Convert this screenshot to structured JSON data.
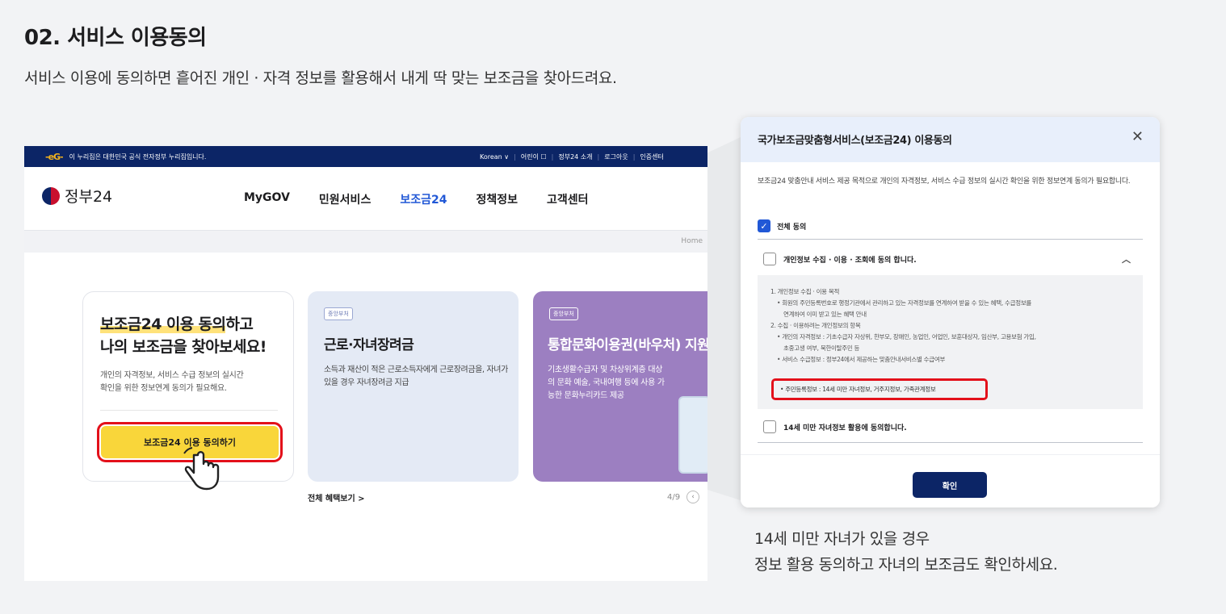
{
  "section": {
    "title": "02. 서비스 이용동의",
    "description": "서비스 이용에 동의하면 흩어진 개인 · 자격 정보를 활용해서 내게 딱 맞는 보조금을 찾아드려요.",
    "caption_line1": "14세 미만 자녀가 있을 경우",
    "caption_line2": "정보 활용 동의하고 자녀의 보조금도 확인하세요."
  },
  "gov_site": {
    "notice": "이 누리집은 대한민국 공식 전자정부 누리집입니다.",
    "util_links": [
      "Korean ∨",
      "어린이 ☐",
      "정부24 소개",
      "로그아웃",
      "인증센터"
    ],
    "logo_text": "정부24",
    "menu": [
      "MyGOV",
      "민원서비스",
      "보조금24",
      "정책정보",
      "고객센터"
    ],
    "breadcrumb": "Home",
    "card_consent": {
      "title_line1_hl": "보조금24 이용 동의",
      "title_line1_rest": "하고",
      "title_line2": "나의 보조금을 찾아보세요!",
      "desc_line1": "개인의 자격정보, 서비스 수급 정보의 실시간",
      "desc_line2": "확인을 위한 정보연계 동의가 필요해요.",
      "button": "보조금24 이용 동의하기"
    },
    "card_benefit1": {
      "badge": "중앙부처",
      "title": "근로·자녀장려금",
      "desc": "소득과 재산이 적은 근로소득자에게 근로장려금을, 자녀가 있을 경우 자녀장려금 지급"
    },
    "card_benefit2": {
      "badge": "중앙부처",
      "title": "통합문화이용권(바우처) 지원",
      "desc": "기초생활수급자 및 차상위계층 대상의 문화 예술, 국내여행 등에 사용 가능한 문화누리카드 제공"
    },
    "more_link": "전체 혜택보기 >",
    "pager": "4/9"
  },
  "modal": {
    "title": "국가보조금맞춤형서비스(보조금24) 이용동의",
    "close": "✕",
    "intro": "보조금24 맞춤안내 서비스 제공 목적으로 개인의 자격정보, 서비스 수급 정보의 실시간 확인을 위한 정보연계 동의가 필요합니다.",
    "agree_all": "전체 동의",
    "item1": "개인정보 수집 · 이용 · 조회에 동의 합니다.",
    "detail_lines": [
      "1. 개인정보 수집 · 이용 목적",
      "• 회원의 주민등록번호로 행정기관에서 관리하고 있는 자격정보를 연계하여 받을 수 있는 혜택, 수급정보를",
      "연계하여 이미 받고 있는 혜택 안내",
      "2. 수집 · 이용하려는 개인정보의 항목",
      "• 개인의 자격정보 : 기초수급자 자상위, 한부모, 장애인, 농업인, 어업인, 보훈대상자, 임산부, 고용보험 가입,",
      "초중고생 여부, 북한이탈주민 등",
      "• 서비스 수급정보 : 정부24에서 제공하는 맞춤안내서비스별 수급여부"
    ],
    "highlight_line": "• 주민등록정보 : 14세 미만 자녀정보, 거주지정보, 가족관계정보",
    "item2": "14세 미만 자녀정보 활용에 동의합니다.",
    "confirm": "확인"
  }
}
